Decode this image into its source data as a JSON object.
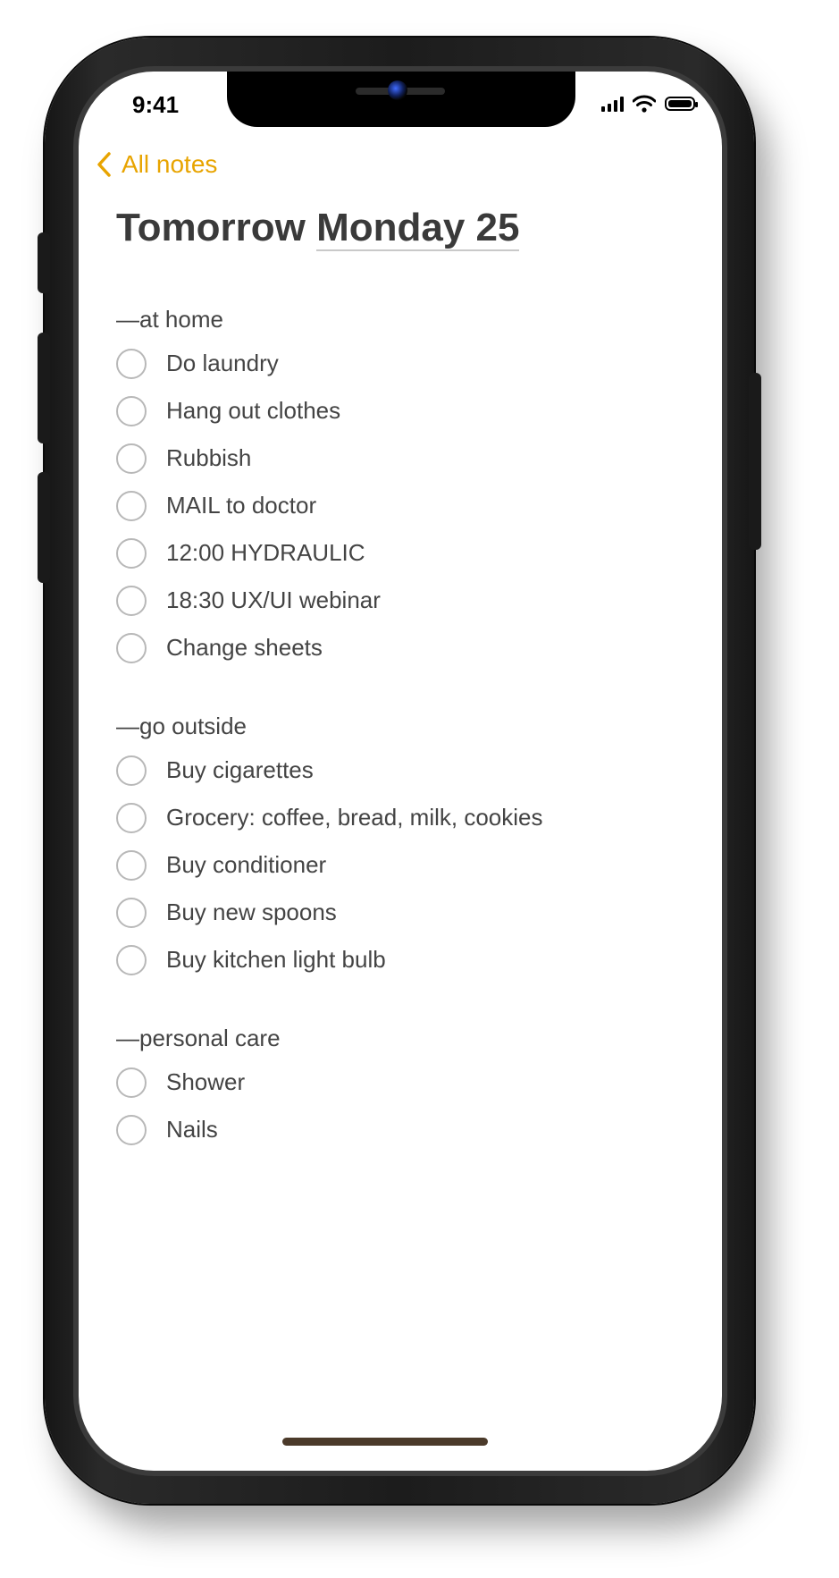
{
  "status_bar": {
    "time": "9:41"
  },
  "nav": {
    "back_label": "All notes"
  },
  "note": {
    "title_plain": "Tomorrow ",
    "title_underlined": "Monday 25"
  },
  "sections": [
    {
      "title": "—at home",
      "items": [
        "Do laundry",
        "Hang out clothes",
        "Rubbish",
        "MAIL to doctor",
        "12:00 HYDRAULIC",
        "18:30 UX/UI webinar",
        "Change sheets"
      ]
    },
    {
      "title": "—go outside",
      "items": [
        "Buy cigarettes",
        "Grocery: coffee, bread, milk, cookies",
        "Buy conditioner",
        "Buy new spoons",
        "Buy kitchen light bulb"
      ]
    },
    {
      "title": "—personal care",
      "items": [
        "Shower",
        "Nails"
      ]
    }
  ],
  "colors": {
    "accent": "#e8a400",
    "text": "#444444",
    "title": "#3a3a3a"
  },
  "icons": {
    "back": "chevron-left-icon",
    "signal": "cellular-signal-icon",
    "wifi": "wifi-icon",
    "battery": "battery-icon"
  }
}
